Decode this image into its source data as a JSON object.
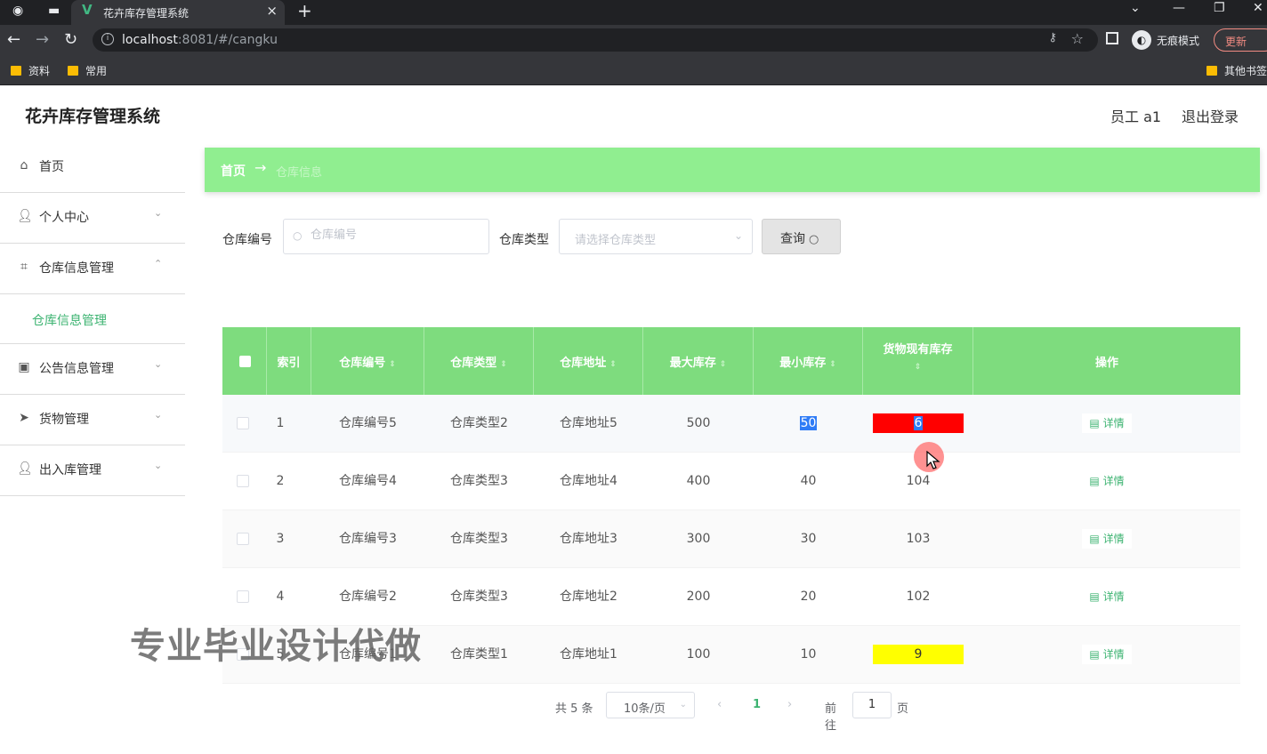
{
  "browser": {
    "tab_title": "花卉库存管理系统",
    "url_host": "localhost",
    "url_path": ":8081/#/cangku",
    "incognito_label": "无痕模式",
    "update_label": "更新",
    "bookmarks": [
      "资料",
      "常用"
    ],
    "other_bookmarks": "其他书签"
  },
  "header": {
    "title": "花卉库存管理系统",
    "user": "员工 a1",
    "logout": "退出登录"
  },
  "sidebar": {
    "items": [
      {
        "label": "首页",
        "icon": "home-icon"
      },
      {
        "label": "个人中心",
        "icon": "user-icon"
      },
      {
        "label": "仓库信息管理",
        "icon": "crop-icon"
      },
      {
        "label": "仓库信息管理",
        "icon": "none"
      },
      {
        "label": "公告信息管理",
        "icon": "briefcase-icon"
      },
      {
        "label": "货物管理",
        "icon": "send-icon"
      },
      {
        "label": "出入库管理",
        "icon": "user-icon"
      }
    ]
  },
  "breadcrumb": {
    "home": "首页",
    "current": "仓库信息"
  },
  "search": {
    "code_label": "仓库编号",
    "code_placeholder": "仓库编号",
    "type_label": "仓库类型",
    "type_placeholder": "请选择仓库类型",
    "query_label": "查询"
  },
  "table": {
    "headers": [
      "索引",
      "仓库编号",
      "仓库类型",
      "仓库地址",
      "最大库存",
      "最小库存",
      "货物现有库存",
      "操作"
    ],
    "rows": [
      {
        "index": "1",
        "code": "仓库编号5",
        "type": "仓库类型2",
        "address": "仓库地址5",
        "max": "500",
        "min": "50",
        "stock": "6",
        "action": "详情"
      },
      {
        "index": "2",
        "code": "仓库编号4",
        "type": "仓库类型3",
        "address": "仓库地址4",
        "max": "400",
        "min": "40",
        "stock": "104",
        "action": "详情"
      },
      {
        "index": "3",
        "code": "仓库编号3",
        "type": "仓库类型3",
        "address": "仓库地址3",
        "max": "300",
        "min": "30",
        "stock": "103",
        "action": "详情"
      },
      {
        "index": "4",
        "code": "仓库编号2",
        "type": "仓库类型3",
        "address": "仓库地址2",
        "max": "200",
        "min": "20",
        "stock": "102",
        "action": "详情"
      },
      {
        "index": "5",
        "code": "仓库编号1",
        "type": "仓库类型1",
        "address": "仓库地址1",
        "max": "100",
        "min": "10",
        "stock": "9",
        "action": "详情"
      }
    ],
    "highlight_colors": {
      "low": "#ff0000",
      "warn": "#ffff00"
    }
  },
  "pagination": {
    "total": "共 5 条",
    "page_size": "10条/页",
    "current_page": "1",
    "goto_label": "前往",
    "goto_value": "1",
    "page_word": "页"
  },
  "watermark": "专业毕业设计代做",
  "colors": {
    "accent": "#90ee90",
    "header_green": "#7edc7e",
    "link_green": "#3cb371"
  }
}
